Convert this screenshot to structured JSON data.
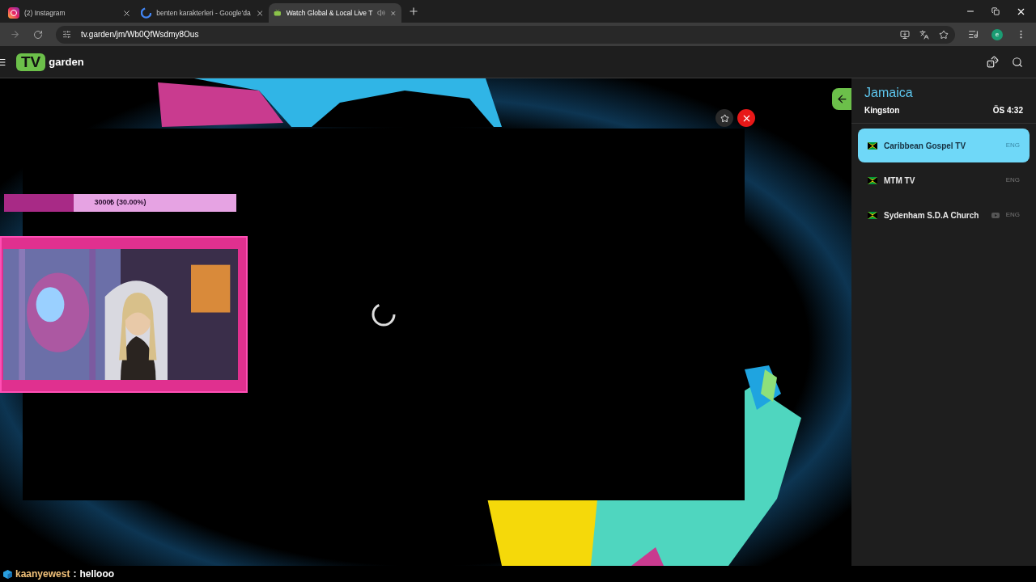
{
  "browser": {
    "tabs": [
      {
        "kind": "instagram",
        "title": "(2) Instagram",
        "selected": false,
        "audio": false
      },
      {
        "kind": "google",
        "title": "benten karakterleri - Google'da",
        "selected": false,
        "audio": false
      },
      {
        "kind": "tv",
        "title": "Watch Global & Local Live T",
        "selected": true,
        "audio": true
      }
    ],
    "address": "tv.garden/jm/Wb0QfWsdmy8Ous",
    "profile_initial": "e"
  },
  "app": {
    "logo_badge": "TV",
    "logo_text": "garden"
  },
  "country": {
    "name": "Jamaica",
    "city": "Kingston",
    "time": "ÖS 4:32"
  },
  "channels": [
    {
      "name": "Caribbean Gospel TV",
      "language": "ENG",
      "selected": true,
      "youtube": false
    },
    {
      "name": "MTM TV",
      "language": "ENG",
      "selected": false,
      "youtube": false
    },
    {
      "name": "Sydenham S.D.A Church",
      "language": "ENG",
      "selected": false,
      "youtube": true
    }
  ],
  "goal": {
    "label": "3000₺ (30.00%)",
    "level": 0.3
  },
  "chat": {
    "user": "kaanyewest",
    "separator": ":",
    "message": "hellooo"
  }
}
